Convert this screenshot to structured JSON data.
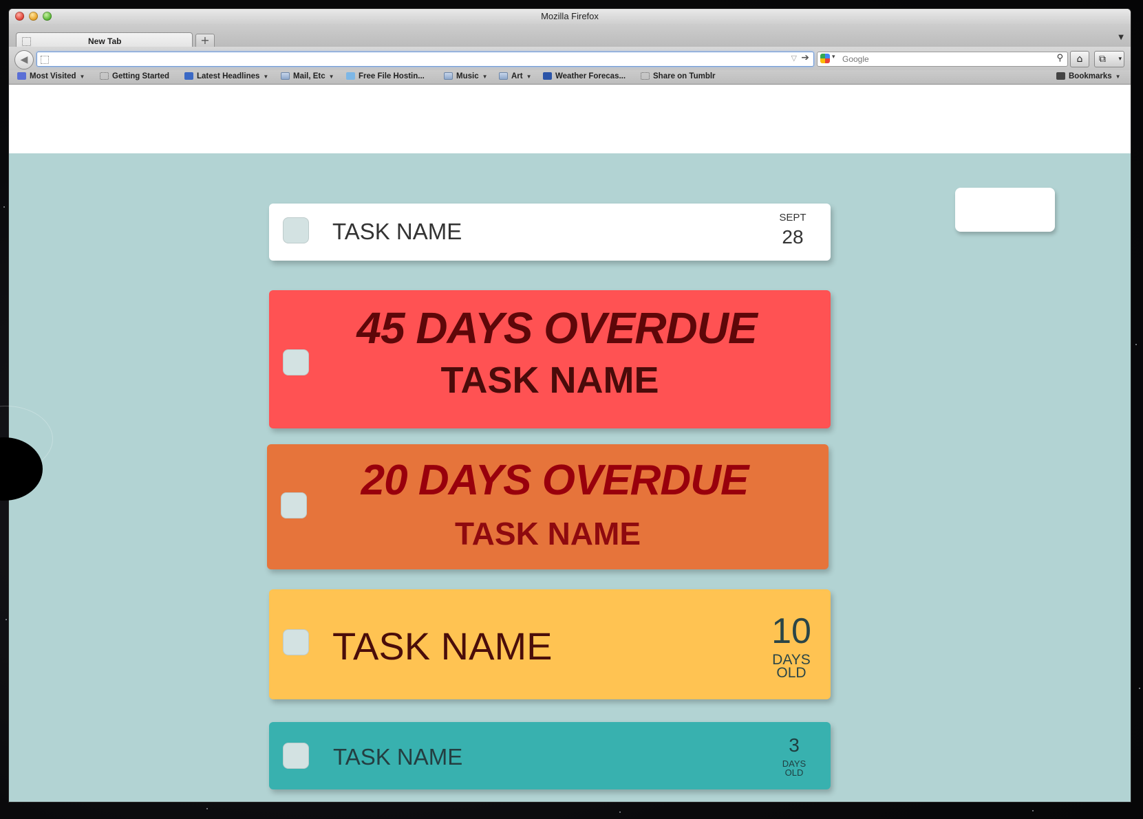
{
  "window": {
    "title": "Mozilla Firefox"
  },
  "tabs": [
    {
      "label": "New Tab"
    }
  ],
  "new_tab_button": "+",
  "url_bar": {
    "value": "",
    "placeholder": ""
  },
  "search_bar": {
    "placeholder": "Google",
    "engine": "Google"
  },
  "bookmarks": [
    {
      "label": "Most Visited",
      "icon": "most-visited-icon",
      "dropdown": true
    },
    {
      "label": "Getting Started",
      "icon": "page-icon",
      "dropdown": false
    },
    {
      "label": "Latest Headlines",
      "icon": "rss-icon",
      "dropdown": true
    },
    {
      "label": "Mail, Etc",
      "icon": "folder-icon",
      "dropdown": true
    },
    {
      "label": "Free File Hostin...",
      "icon": "fish-icon",
      "dropdown": false
    },
    {
      "label": "Music",
      "icon": "folder-icon",
      "dropdown": true
    },
    {
      "label": "Art",
      "icon": "folder-icon",
      "dropdown": true
    },
    {
      "label": "Weather Forecas...",
      "icon": "weather-icon",
      "dropdown": false
    },
    {
      "label": "Share on Tumblr",
      "icon": "page-icon",
      "dropdown": false
    }
  ],
  "bookmarks_menu": "Bookmarks",
  "tasks": [
    {
      "name": "TASK NAME",
      "date_month": "SEPT",
      "date_day": "28",
      "color": "#ffffff"
    },
    {
      "name": "TASK NAME",
      "overdue": "45 DAYS OVERDUE",
      "color": "#ff5253"
    },
    {
      "name": "TASK NAME",
      "overdue": "20 DAYS OVERDUE",
      "color": "#e6743b"
    },
    {
      "name": "TASK NAME",
      "age_number": "10",
      "age_line1": "DAYS",
      "age_line2": "OLD",
      "color": "#ffc352"
    },
    {
      "name": "TASK NAME",
      "age_number": "3",
      "age_line1": "DAYS",
      "age_line2": "OLD",
      "color": "#38b1af"
    }
  ],
  "colors": {
    "background": "#b2d3d3",
    "checkbox": "#d3e2e2"
  }
}
